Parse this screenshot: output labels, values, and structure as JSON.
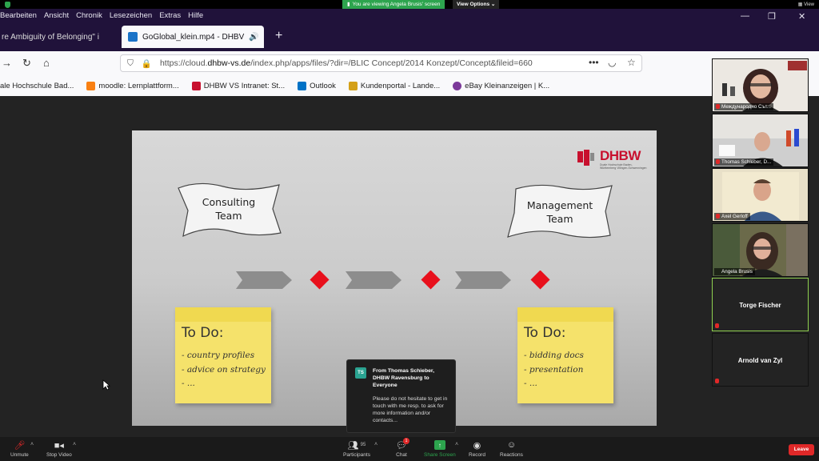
{
  "zoom": {
    "banner": "You are viewing Angela Brusis' screen",
    "view_options": "View Options",
    "view_label": "View"
  },
  "browser": {
    "menu": [
      "Bearbeiten",
      "Ansicht",
      "Chronik",
      "Lesezeichen",
      "Extras",
      "Hilfe"
    ],
    "tab_inactive": "re Ambiguity of Belonging\" i",
    "tab_active": "GoGlobal_klein.mp4 - DHBV",
    "url_prefix": "https://cloud.",
    "url_domain": "dhbw-vs.de",
    "url_rest": "/index.php/apps/files/?dir=/BLIC Concept/2014 Konzept/Concept&fileid=660",
    "url_more": "•••",
    "bookmarks": [
      {
        "label": "ale Hochschule Bad...",
        "icon_color": "#ffffff"
      },
      {
        "label": "moodle: Lernplattform...",
        "icon_color": "#f98012"
      },
      {
        "label": "DHBW VS Intranet: St...",
        "icon_color": "#c8102e"
      },
      {
        "label": "Outlook",
        "icon_color": "#0072c6"
      },
      {
        "label": "Kundenportal - Lande...",
        "icon_color": "#d4a017"
      },
      {
        "label": "eBay Kleinanzeigen | K...",
        "icon_color": "#7c3a9a"
      }
    ]
  },
  "slide": {
    "logo": "DHBW",
    "logo_sub": "Duale Hochschule Baden-Württemberg Villingen-Schwenningen",
    "flag_left": [
      "Consulting",
      "Team"
    ],
    "flag_right": [
      "Management",
      "Team"
    ],
    "todo_left": {
      "title": "To Do:",
      "items": [
        "- country profiles",
        "- advice on strategy",
        "- ..."
      ]
    },
    "todo_right": {
      "title": "To Do:",
      "items": [
        "- bidding docs",
        "- presentation",
        "- ..."
      ]
    }
  },
  "chat_toast": {
    "initials": "TS",
    "from": "From Thomas Schieber, DHBW Ravensburg to Everyone",
    "message": "Please do not hesitate to get in touch with me resp. to ask for more information and/or contacts..."
  },
  "participants": [
    {
      "name": "Международно Сът...",
      "type": "video"
    },
    {
      "name": "Thomas Schieber, D...",
      "type": "video"
    },
    {
      "name": "Axel Gerloff",
      "type": "video"
    },
    {
      "name": "Angela Brusis",
      "type": "video"
    },
    {
      "name": "Torge Fischer",
      "type": "name"
    },
    {
      "name": "Arnold van Zyl",
      "type": "name"
    }
  ],
  "toolbar": {
    "unmute": "Unmute",
    "stop_video": "Stop Video",
    "participants": "Participants",
    "participant_count": "95",
    "chat": "Chat",
    "chat_badge": "1",
    "share": "Share Screen",
    "record": "Record",
    "reactions": "Reactions",
    "leave": "Leave"
  },
  "colors": {
    "share_green": "#2da44e",
    "leave_red": "#e02828",
    "dhbw_red": "#c8102e",
    "sticky_yellow": "#f5e26b"
  }
}
